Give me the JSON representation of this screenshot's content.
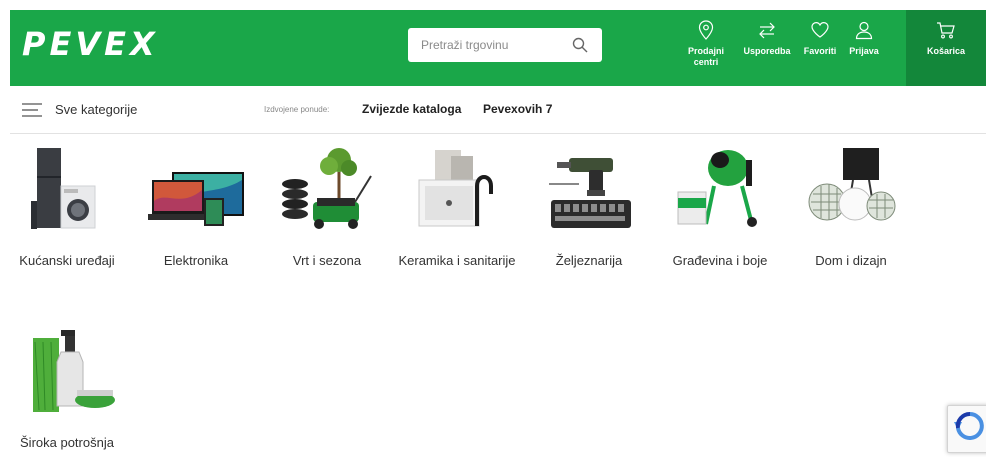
{
  "header": {
    "logo_text": "PEVEX",
    "search_placeholder": "Pretraži trgovinu",
    "items": [
      {
        "label": "Prodajni centri",
        "icon": "location-pin-icon"
      },
      {
        "label": "Usporedba",
        "icon": "compare-arrows-icon"
      },
      {
        "label": "Favoriti",
        "icon": "heart-icon"
      },
      {
        "label": "Prijava",
        "icon": "user-icon"
      }
    ],
    "cart_label": "Košarica",
    "colors": {
      "brand_green": "#1aa749",
      "cart_green": "#13873a"
    }
  },
  "subnav": {
    "all_categories": "Sve kategorije",
    "featured_label": "Izdvojene ponude:",
    "featured": [
      "Zvijezde kataloga",
      "Pevexovih 7"
    ]
  },
  "categories": [
    {
      "label": "Kućanski uređaji",
      "icon": "appliances-image"
    },
    {
      "label": "Elektronika",
      "icon": "electronics-image"
    },
    {
      "label": "Vrt i sezona",
      "icon": "garden-image"
    },
    {
      "label": "Keramika i sanitarije",
      "icon": "sink-image"
    },
    {
      "label": "Željeznarija",
      "icon": "tools-image"
    },
    {
      "label": "Građevina i boje",
      "icon": "cement-mixer-image"
    },
    {
      "label": "Dom i dizajn",
      "icon": "home-decor-image"
    },
    {
      "label": "Široka potrošnja",
      "icon": "cleaning-image"
    }
  ]
}
